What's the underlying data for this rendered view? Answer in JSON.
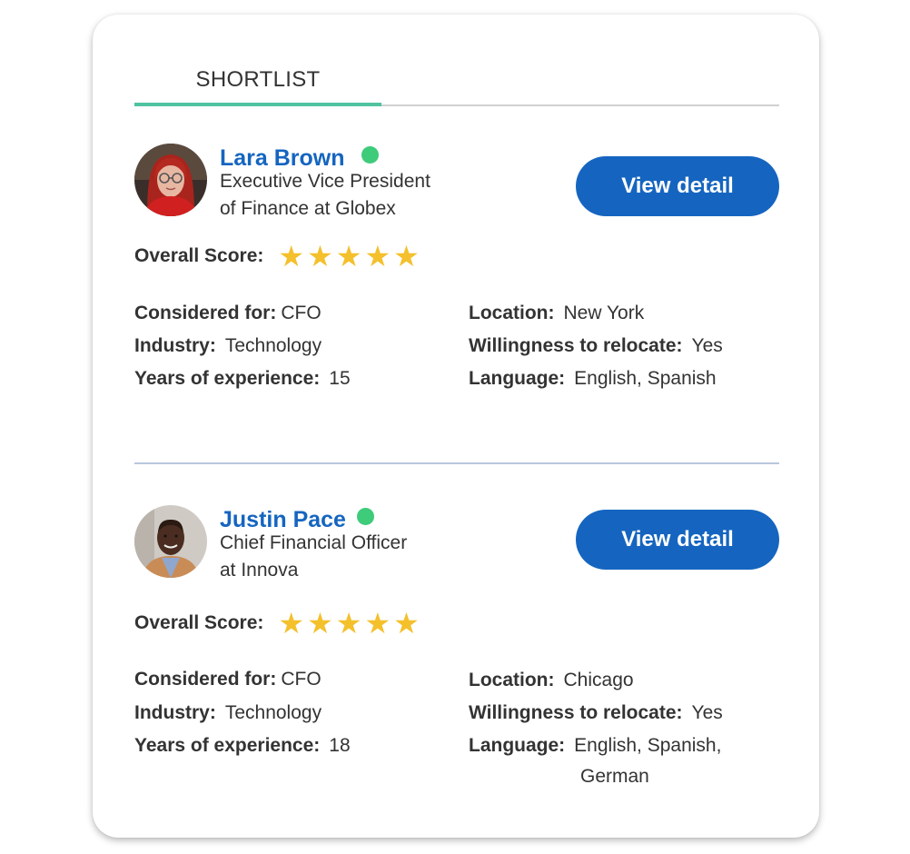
{
  "tabs": [
    {
      "label": "SHORTLIST",
      "active": true
    }
  ],
  "colors": {
    "accent_tab": "#4fc39f",
    "primary": "#1565c0",
    "online": "#3ecb7a",
    "star": "#f4c02c"
  },
  "candidates": [
    {
      "name": "Lara Brown",
      "status": "online",
      "title_line1": "Executive Vice President",
      "title_line2": "of Finance at Globex",
      "view_label": "View detail",
      "score_label": "Overall Score:",
      "score": 5,
      "score_max": 5,
      "star_glyph": "★",
      "fields": {
        "considered_for": {
          "label": "Considered for:",
          "value": "CFO"
        },
        "industry": {
          "label": "Industry:",
          "value": "Technology"
        },
        "years": {
          "label": "Years of experience:",
          "value": "15"
        },
        "location": {
          "label": "Location:",
          "value": "New York"
        },
        "relocate": {
          "label": "Willingness to relocate:",
          "value": "Yes"
        },
        "language": {
          "label": "Language:",
          "value": "English, Spanish",
          "value_line2": ""
        }
      }
    },
    {
      "name": "Justin Pace",
      "status": "online",
      "title_line1": "Chief Financial Officer",
      "title_line2": "at Innova",
      "view_label": "View detail",
      "score_label": "Overall Score:",
      "score": 5,
      "score_max": 5,
      "star_glyph": "★",
      "fields": {
        "considered_for": {
          "label": "Considered for:",
          "value": "CFO"
        },
        "industry": {
          "label": "Industry:",
          "value": "Technology"
        },
        "years": {
          "label": "Years of experience:",
          "value": "18"
        },
        "location": {
          "label": "Location:",
          "value": "Chicago"
        },
        "relocate": {
          "label": "Willingness to relocate:",
          "value": "Yes"
        },
        "language": {
          "label": "Language:",
          "value": "English, Spanish,",
          "value_line2": "German"
        }
      }
    }
  ]
}
